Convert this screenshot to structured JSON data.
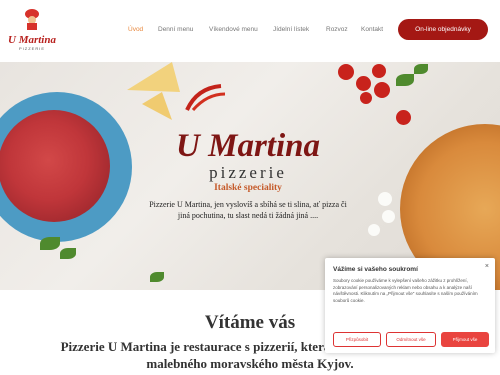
{
  "logo": {
    "brand": "U Martina",
    "sub": "PIZZERIE"
  },
  "nav": {
    "items": [
      "Úvod",
      "Denní menu",
      "Víkendové menu",
      "Jídelní lístek",
      "Rozvoz",
      "Kontakt"
    ],
    "active": "Úvod",
    "order_label": "On-line objednávky"
  },
  "hero": {
    "title": "U Martina",
    "subtitle": "pizzerie",
    "tagline": "Italské speciality",
    "text": "Pizzerie U Martina, jen vyslovíš a sbíhá se ti slina, ať pizza či jiná pochutina, tu slast nedá ti žádná jiná ...."
  },
  "welcome": {
    "heading": "Vítáme vás",
    "line1": "Pizzerie U Martina je restaurace s pizzerií, která se nachází v centru",
    "line2": "malebného moravského města Kyjov."
  },
  "cookie": {
    "title": "Vážíme si vašeho soukromí",
    "close": "×",
    "text": "Soubory cookie používáme k vylepšení vašeho zážitku z prohlížení, zobrazování personalizovaných reklam nebo obsahu a k analýze naší návštěvnosti. Kliknutím na „Přijmout vše\" souhlasíte s naším používáním souborů cookie.",
    "customize_label": "Přizpůsobit",
    "reject_label": "Odmítnout vše",
    "accept_label": "Přijmout vše"
  },
  "colors": {
    "brand": "#a41814",
    "accent": "#e8893f",
    "cookie_accent": "#e9443f"
  }
}
